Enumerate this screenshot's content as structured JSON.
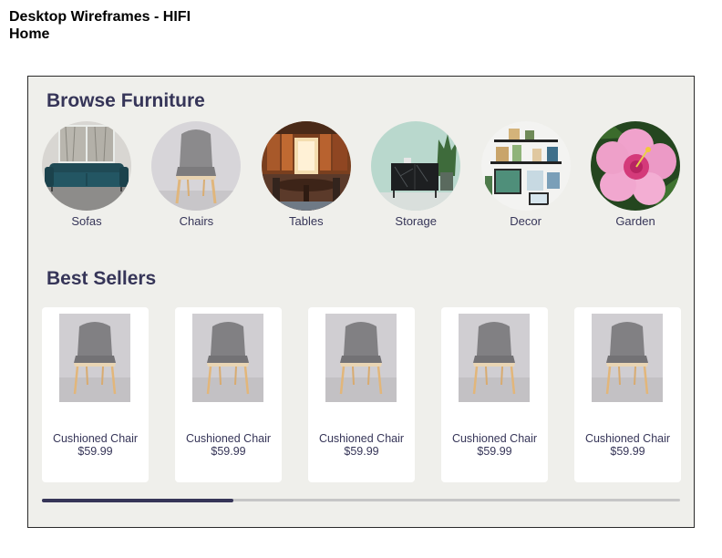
{
  "document": {
    "title_line1": "Desktop Wireframes - HIFI",
    "title_line2": "Home"
  },
  "browse": {
    "title": "Browse Furniture",
    "categories": [
      {
        "label": "Sofas",
        "icon": "sofa-photo"
      },
      {
        "label": "Chairs",
        "icon": "chair-photo"
      },
      {
        "label": "Tables",
        "icon": "dining-room-photo"
      },
      {
        "label": "Storage",
        "icon": "cabinet-photo"
      },
      {
        "label": "Decor",
        "icon": "wall-decor-photo"
      },
      {
        "label": "Garden",
        "icon": "hibiscus-flower-photo"
      }
    ]
  },
  "best_sellers": {
    "title": "Best Sellers",
    "products": [
      {
        "name": "Cushioned Chair",
        "price": "$59.99"
      },
      {
        "name": "Cushioned Chair",
        "price": "$59.99"
      },
      {
        "name": "Cushioned Chair",
        "price": "$59.99"
      },
      {
        "name": "Cushioned Chair",
        "price": "$59.99"
      },
      {
        "name": "Cushioned Chair",
        "price": "$59.99"
      }
    ]
  },
  "scroll": {
    "progress": 0.3
  },
  "colors": {
    "accent": "#363558",
    "frame_background": "#efefeb",
    "card_background": "#ffffff",
    "scroll_track": "#c6c6c6"
  }
}
